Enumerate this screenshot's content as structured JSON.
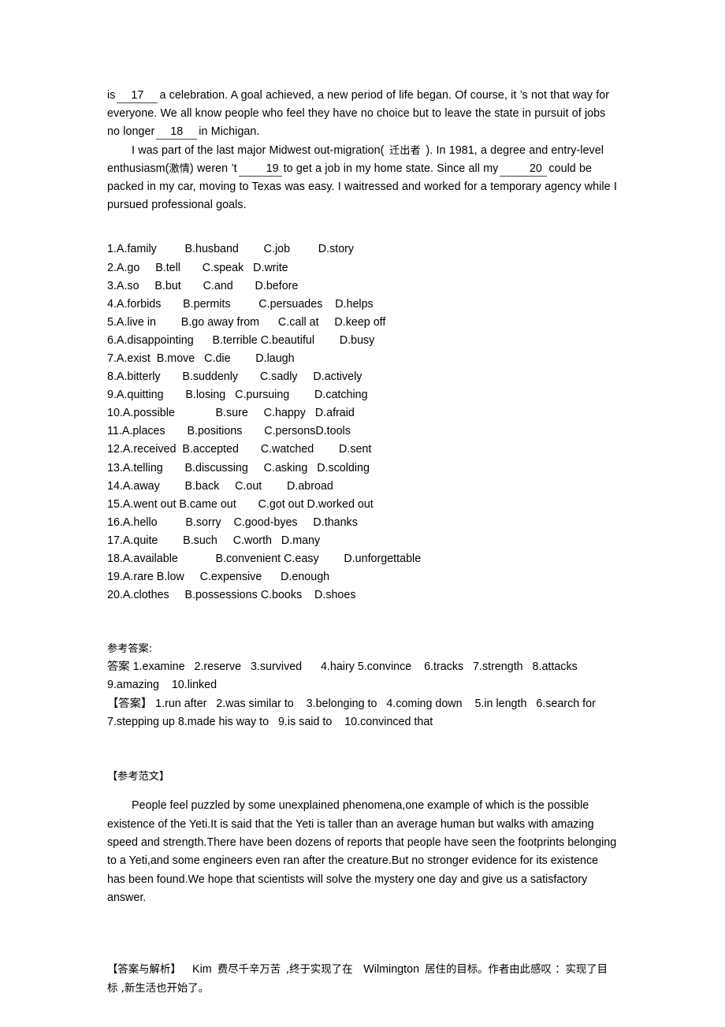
{
  "document": {
    "passage": {
      "paragraph1_part1": "is",
      "blank17": "17",
      "paragraph1_part2": "a celebration. A goal achieved, a new period of life began. Of course, it    ’s not that way for everyone. We all know people who feel they have no choice but to leave the state in pursuit of jobs no longer",
      "blank18": "18",
      "paragraph1_part3": "in Michigan.",
      "paragraph2_part1": "I was part of the last major Midwest out-migration(",
      "gloss1": "迁出者",
      "paragraph2_part2": "). In 1981, a degree and entry-level enthusiasm(",
      "gloss2": "激情",
      "paragraph2_part3": ") weren ’t",
      "blank19": "19",
      "paragraph2_part4": "to get a job in my home state. Since all my",
      "blank20": "20",
      "paragraph2_part5": "could be packed in my car, moving to Texas was easy. I waitressed and worked for a temporary agency while I pursued professional goals."
    },
    "options": [
      "1.A.family         B.husband        C.job         D.story",
      "2.A.go     B.tell       C.speak   D.write",
      "3.A.so     B.but       C.and       D.before",
      "4.A.forbids       B.permits         C.persuades    D.helps",
      "5.A.live in        B.go away from      C.call at     D.keep off",
      "6.A.disappointing      B.terrible C.beautiful        D.busy",
      "7.A.exist  B.move   C.die        D.laugh",
      "8.A.bitterly       B.suddenly       C.sadly     D.actively",
      "9.A.quitting       B.losing   C.pursuing        D.catching",
      "10.A.possible             B.sure     C.happy   D.afraid",
      "11.A.places       B.positions       C.personsD.tools",
      "12.A.received  B.accepted       C.watched        D.sent",
      "13.A.telling       B.discussing     C.asking   D.scolding",
      "14.A.away        B.back     C.out        D.abroad",
      "15.A.went out B.came out       C.got out D.worked out",
      "16.A.hello         B.sorry    C.good-byes     D.thanks",
      "17.A.quite        B.such     C.worth   D.many",
      "18.A.available            B.convenient C.easy        D.unforgettable",
      "19.A.rare B.low     C.expensive      D.enough",
      "20.A.clothes     B.possessions C.books    D.shoes"
    ],
    "answer_key": {
      "heading": "参考答案:",
      "line1": "答案 1.examine   2.reserve   3.survived      4.hairy 5.convince    6.tracks   7.strength   8.attacks 9.amazing    10.linked",
      "line2": "【答案】 1.run after   2.was similar to    3.belonging to   4.coming down    5.in length   6.search for   7.stepping up 8.made his way to   9.is said to    10.convinced that"
    },
    "model_essay": {
      "heading": "【参考范文】",
      "body": "People feel puzzled by some unexplained phenomena,one example of which is the possible existence of the Yeti.It is said that the Yeti is taller than an average human but walks with amazing speed and strength.There have been dozens of reports that people have seen the footprints belonging to a Yeti,and some engineers even ran after the creature.But no stronger evidence for its existence has been found.We hope that scientists will solve the mystery one day and give us a satisfactory answer."
    },
    "analysis": {
      "label": "【答案与解析】",
      "name1": "Kim",
      "text1": "费尽千辛万苦",
      "text2": ",终于实现了在",
      "name2": "Wilmington",
      "text3": "居住的目标。作者由此感叹    ：",
      "text4": "实现了目标 ,新生活也开始了。"
    }
  }
}
